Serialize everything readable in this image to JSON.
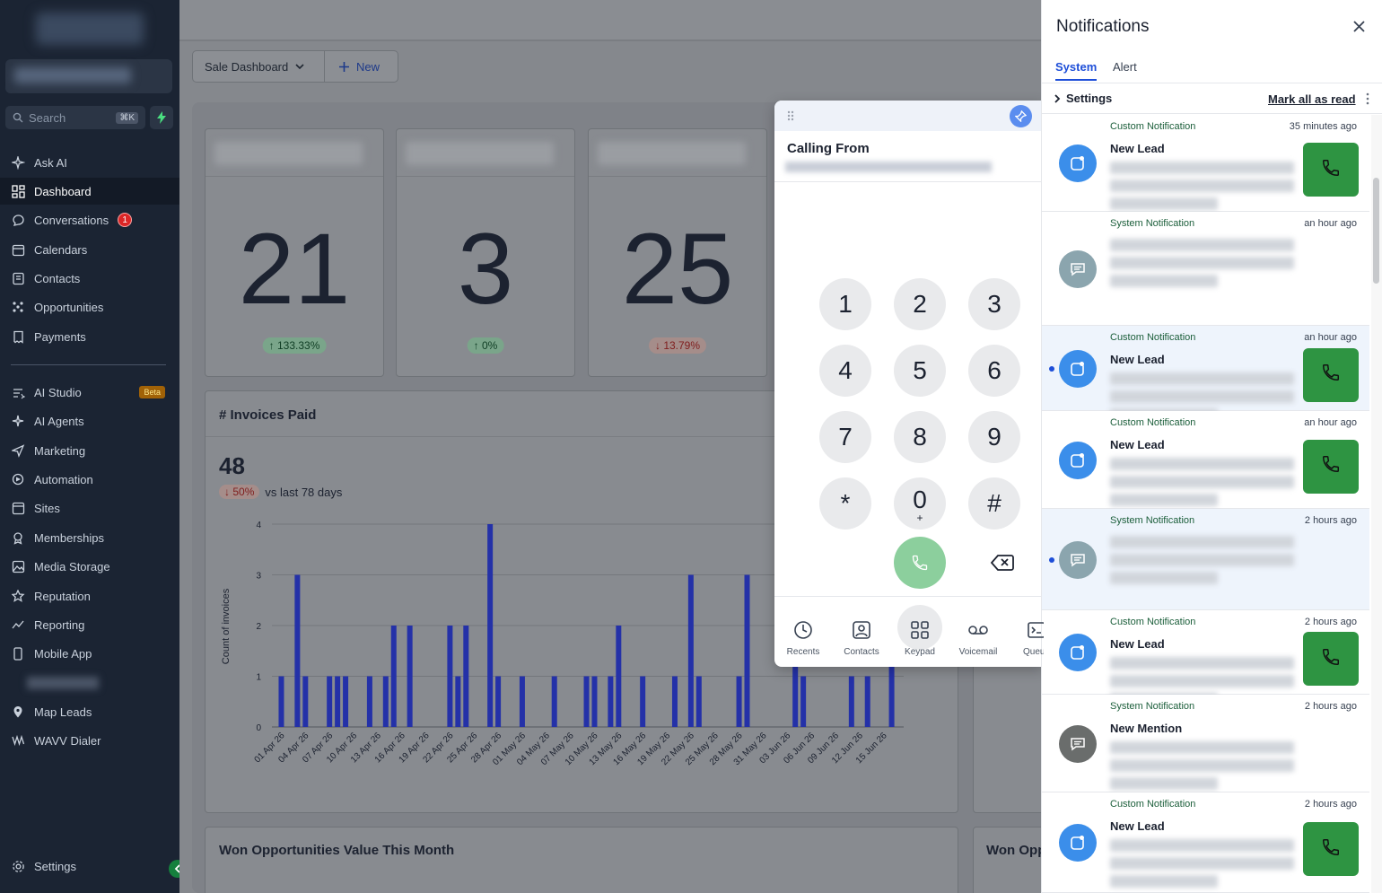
{
  "sidebar": {
    "search_placeholder": "Search",
    "search_shortcut": "⌘K",
    "items": [
      {
        "label": "Ask AI",
        "icon": "sparkle-icon"
      },
      {
        "label": "Dashboard",
        "icon": "grid-icon",
        "active": true
      },
      {
        "label": "Conversations",
        "icon": "chat-icon",
        "badge": "1"
      },
      {
        "label": "Calendars",
        "icon": "calendar-icon"
      },
      {
        "label": "Contacts",
        "icon": "contacts-icon"
      },
      {
        "label": "Opportunities",
        "icon": "funnel-icon"
      },
      {
        "label": "Payments",
        "icon": "receipt-icon"
      },
      {
        "label": "AI Studio",
        "icon": "ai-studio-icon",
        "tag": "Beta"
      },
      {
        "label": "AI Agents",
        "icon": "ai-agent-icon"
      },
      {
        "label": "Marketing",
        "icon": "send-icon"
      },
      {
        "label": "Automation",
        "icon": "automation-icon"
      },
      {
        "label": "Sites",
        "icon": "globe-icon"
      },
      {
        "label": "Memberships",
        "icon": "award-icon"
      },
      {
        "label": "Media Storage",
        "icon": "image-icon"
      },
      {
        "label": "Reputation",
        "icon": "star-icon"
      },
      {
        "label": "Reporting",
        "icon": "trend-icon"
      },
      {
        "label": "Mobile App",
        "icon": "phone-icon"
      },
      {
        "label": "Map Leads",
        "icon": "pin-icon"
      },
      {
        "label": "WAVV Dialer",
        "icon": "wave-icon"
      }
    ],
    "settings_label": "Settings"
  },
  "toolbar": {
    "dashboard_select": "Sale Dashboard",
    "new_label": "New"
  },
  "stats": [
    {
      "value": "21",
      "change": "133.33%",
      "direction": "up"
    },
    {
      "value": "3",
      "change": "0%",
      "direction": "up"
    },
    {
      "value": "25",
      "change": "13.79%",
      "direction": "down"
    }
  ],
  "invoices": {
    "title": "# Invoices Paid",
    "total": "48",
    "change": "50%",
    "compare": "vs last 78 days"
  },
  "chart_data": {
    "type": "bar",
    "title": "# Invoices Paid",
    "xlabel": "",
    "ylabel": "Count of invoices",
    "ylim": [
      0,
      4
    ],
    "yticks": [
      "0",
      "1",
      "2",
      "3",
      "4"
    ],
    "tick_labels": [
      "01 Apr 26",
      "04 Apr 26",
      "07 Apr 26",
      "10 Apr 26",
      "13 Apr 26",
      "16 Apr 26",
      "19 Apr 26",
      "22 Apr 26",
      "25 Apr 26",
      "28 Apr 26",
      "01 May 26",
      "04 May 26",
      "07 May 26",
      "10 May 26",
      "13 May 26",
      "16 May 26",
      "19 May 26",
      "22 May 26",
      "25 May 26",
      "28 May 26",
      "31 May 26",
      "03 Jun 26",
      "06 Jun 26",
      "09 Jun 26",
      "12 Jun 26",
      "15 Jun 26"
    ],
    "values": [
      1,
      0,
      1,
      1,
      0,
      0,
      1,
      1,
      1,
      0,
      1,
      0,
      1,
      2,
      2,
      0,
      0,
      2,
      1,
      2,
      0,
      4,
      1,
      0,
      1,
      0,
      0,
      1,
      0,
      0,
      1,
      1,
      0,
      1,
      2,
      0,
      1,
      0,
      1,
      0,
      1,
      3,
      1,
      0,
      0,
      1,
      1,
      0,
      0,
      1,
      1,
      0,
      0,
      1,
      0,
      0,
      0,
      0,
      0,
      0,
      0,
      0,
      0,
      0,
      0,
      0,
      0,
      0,
      0,
      0,
      0,
      0,
      0,
      0,
      0,
      0,
      0,
      0,
      0
    ],
    "bars": [
      {
        "i": 0,
        "v": 1
      },
      {
        "i": 2,
        "v": 3
      },
      {
        "i": 3,
        "v": 1
      },
      {
        "i": 6,
        "v": 1
      },
      {
        "i": 7,
        "v": 1
      },
      {
        "i": 8,
        "v": 1
      },
      {
        "i": 11,
        "v": 1
      },
      {
        "i": 13,
        "v": 1
      },
      {
        "i": 14,
        "v": 2
      },
      {
        "i": 16,
        "v": 2
      },
      {
        "i": 21,
        "v": 2
      },
      {
        "i": 22,
        "v": 1
      },
      {
        "i": 23,
        "v": 2
      },
      {
        "i": 26,
        "v": 4
      },
      {
        "i": 27,
        "v": 1
      },
      {
        "i": 30,
        "v": 1
      },
      {
        "i": 34,
        "v": 1
      },
      {
        "i": 38,
        "v": 1
      },
      {
        "i": 39,
        "v": 1
      },
      {
        "i": 41,
        "v": 1
      },
      {
        "i": 42,
        "v": 2
      },
      {
        "i": 45,
        "v": 1
      },
      {
        "i": 49,
        "v": 1
      },
      {
        "i": 51,
        "v": 3
      },
      {
        "i": 52,
        "v": 1
      },
      {
        "i": 57,
        "v": 1
      },
      {
        "i": 58,
        "v": 3
      },
      {
        "i": 64,
        "v": 3
      },
      {
        "i": 65,
        "v": 1
      },
      {
        "i": 71,
        "v": 1
      },
      {
        "i": 73,
        "v": 1
      },
      {
        "i": 76,
        "v": 2
      }
    ],
    "bar_color": "#2431a8"
  },
  "won": {
    "title": "Won Opportunities Value This Month",
    "title2": "Won Opp"
  },
  "dialer": {
    "calling_from": "Calling From",
    "keys": [
      {
        "d": "1",
        "s": ""
      },
      {
        "d": "2",
        "s": ""
      },
      {
        "d": "3",
        "s": ""
      },
      {
        "d": "4",
        "s": ""
      },
      {
        "d": "5",
        "s": ""
      },
      {
        "d": "6",
        "s": ""
      },
      {
        "d": "7",
        "s": ""
      },
      {
        "d": "8",
        "s": ""
      },
      {
        "d": "9",
        "s": ""
      },
      {
        "d": "*",
        "s": ""
      },
      {
        "d": "0",
        "s": "+"
      },
      {
        "d": "#",
        "s": ""
      }
    ],
    "nav": [
      "Recents",
      "Contacts",
      "Keypad",
      "Voicemail",
      "Queue"
    ]
  },
  "notifications": {
    "title": "Notifications",
    "tabs": [
      "System",
      "Alert"
    ],
    "settings": "Settings",
    "mark_all": "Mark all as read",
    "items": [
      {
        "type": "Custom Notification",
        "time": "35 minutes ago",
        "head": "New Lead",
        "avatar": "blue",
        "unread": false,
        "call": true
      },
      {
        "type": "System Notification",
        "time": "an hour ago",
        "head": "",
        "avatar": "gray",
        "unread": false,
        "call": false
      },
      {
        "type": "Custom Notification",
        "time": "an hour ago",
        "head": "New Lead",
        "avatar": "blue",
        "unread": true,
        "call": true
      },
      {
        "type": "Custom Notification",
        "time": "an hour ago",
        "head": "New Lead",
        "avatar": "blue",
        "unread": false,
        "call": true
      },
      {
        "type": "System Notification",
        "time": "2 hours ago",
        "head": "",
        "avatar": "gray",
        "unread": true,
        "call": false
      },
      {
        "type": "Custom Notification",
        "time": "2 hours ago",
        "head": "New Lead",
        "avatar": "blue",
        "unread": false,
        "call": true
      },
      {
        "type": "System Notification",
        "time": "2 hours ago",
        "head": "New Mention",
        "avatar": "dark",
        "unread": false,
        "call": false
      },
      {
        "type": "Custom Notification",
        "time": "2 hours ago",
        "head": "New Lead",
        "avatar": "blue",
        "unread": false,
        "call": true
      }
    ]
  }
}
